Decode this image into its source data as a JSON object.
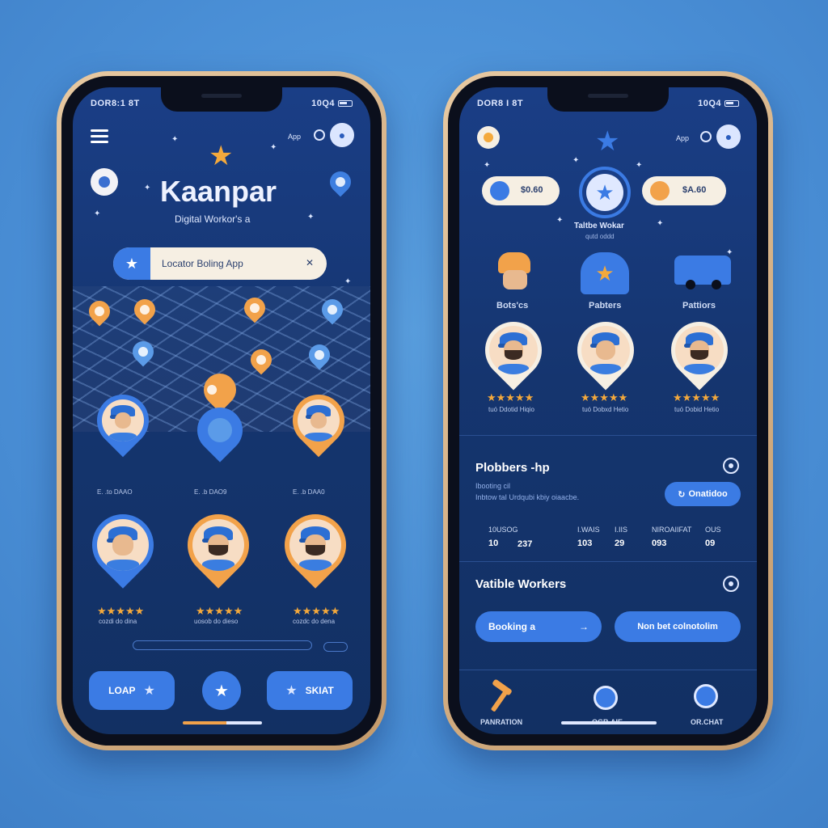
{
  "left": {
    "status_time": "DOR8:1 8T",
    "status_right": "10Q4",
    "app_label": "App",
    "title": "Kaanpar",
    "subtitle": "Digital Workor's a",
    "search_placeholder": "Locator Boling App",
    "pin_labels": [
      "E. .to DAAO",
      "E. .b DAO9",
      "E. .b DAA0"
    ],
    "rating_labels": [
      "cozdi do dina",
      "uosob do dieso",
      "cozdc do dena"
    ],
    "buttons": {
      "left": "LOAP",
      "right": "SKIAT"
    }
  },
  "right": {
    "status_time": "DOR8 I 8T",
    "status_right": "10Q4",
    "app_label": "App",
    "pill_left_value": "$0.60",
    "pill_right_value": "$A.60",
    "center_caption": "Taltbe Wokar",
    "center_caption_sub": "qutd oddd",
    "categories": [
      "Bots'cs",
      "Pabters",
      "Pattiors"
    ],
    "rating_labels": [
      "tuó Ddotid Hiqio",
      "tuó Dobxd Hetio",
      "tuó Dobid Hetio"
    ],
    "plumbers": {
      "title": "Plobbers -hp",
      "line1": "Ibooting cil",
      "line2": "Inbtow taI Urdqubi kbiy oiaacbe.",
      "button": "Onatidoo"
    },
    "stats": [
      {
        "label": "10USOG",
        "value": "10"
      },
      {
        "label": "",
        "value": "237"
      },
      {
        "label": "I.WAIS",
        "value": "103"
      },
      {
        "label": "I.IIS",
        "value": "29"
      },
      {
        "label": "NIROAIIFAT",
        "value": "093"
      },
      {
        "label": "OUS",
        "value": "09"
      }
    ],
    "available": {
      "title": "Vatible Workers",
      "button_left": "Booking a",
      "button_right": "Non bet colnotolim"
    },
    "nav": [
      "PANRATION",
      "OGB.AIE",
      "OR.CHAT"
    ]
  }
}
